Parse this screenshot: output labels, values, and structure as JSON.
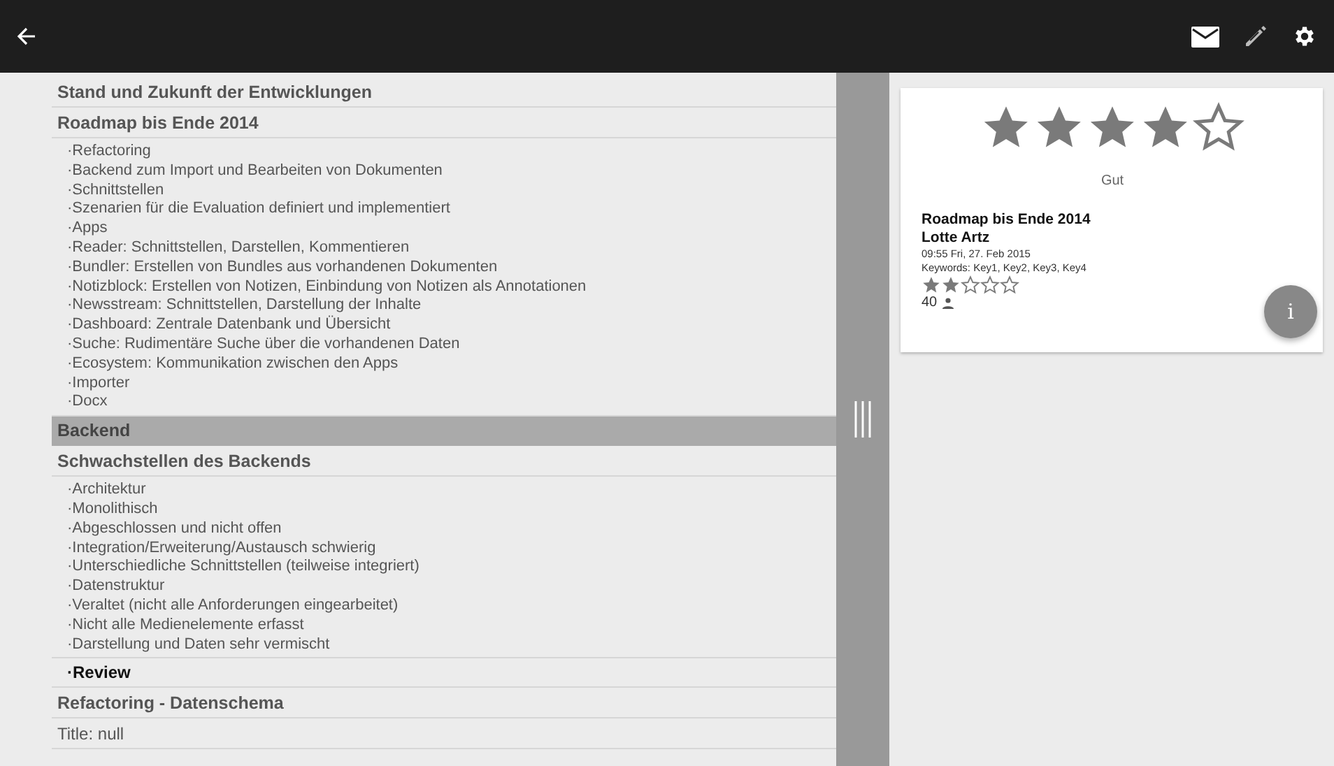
{
  "outline": [
    {
      "kind": "heading",
      "text": "Stand und Zukunft der Entwicklungen",
      "selected": false
    },
    {
      "kind": "heading",
      "text": "Roadmap bis Ende 2014",
      "selected": false
    },
    {
      "kind": "bullets",
      "items": [
        "·Refactoring",
        "·Backend zum Import und Bearbeiten von Dokumenten",
        "·Schnittstellen",
        "·Szenarien für die Evaluation definiert und implementiert",
        "·Apps",
        "·Reader: Schnittstellen, Darstellen, Kommentieren",
        "·Bundler: Erstellen von Bundles aus vorhandenen Dokumenten",
        "·Notizblock: Erstellen von Notizen, Einbindung von Notizen als Annotationen",
        "·Newsstream: Schnittstellen, Darstellung der Inhalte",
        "·Dashboard: Zentrale Datenbank und Übersicht",
        "·Suche: Rudimentäre Suche über die vorhandenen Daten",
        "·Ecosystem: Kommunikation zwischen den Apps",
        "·Importer",
        "·Docx"
      ]
    },
    {
      "kind": "heading",
      "text": "Backend",
      "selected": true
    },
    {
      "kind": "heading",
      "text": "Schwachstellen des Backends",
      "selected": false
    },
    {
      "kind": "bullets",
      "items": [
        "·Architektur",
        "·Monolithisch",
        "·Abgeschlossen und nicht offen",
        "·Integration/Erweiterung/Austausch schwierig",
        "·Unterschiedliche Schnittstellen (teilweise integriert)",
        "·Datenstruktur",
        "·Veraltet (nicht alle Anforderungen eingearbeitet)",
        "·Nicht alle Medienelemente erfasst",
        "·Darstellung und Daten sehr vermischt"
      ]
    },
    {
      "kind": "strong-bullet",
      "text": "·Review"
    },
    {
      "kind": "heading",
      "text": "Refactoring - Datenschema",
      "selected": false
    },
    {
      "kind": "field",
      "text": "Title: null"
    }
  ],
  "card": {
    "rating": {
      "stars": 4
    },
    "rating_label": "Gut",
    "title": "Roadmap bis Ende 2014",
    "author": "Lotte Artz",
    "date": "09:55 Fri, 27. Feb 2015",
    "keywords": "Keywords: Key1, Key2, Key3, Key4",
    "score": {
      "stars": 2
    },
    "count": "40",
    "info_button": "i"
  }
}
